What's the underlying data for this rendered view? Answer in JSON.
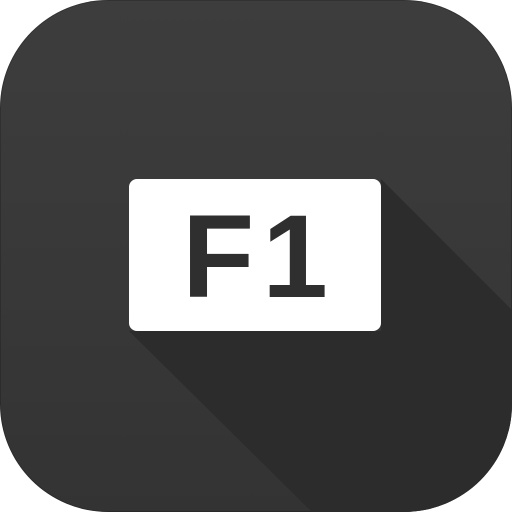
{
  "icon": {
    "semantic": "function-key-icon",
    "key_label": "F1",
    "colors": {
      "tile_background": "#3a3a3a",
      "long_shadow": "#2b2b2b",
      "key_cap": "#ffffff",
      "key_text": "#2f2f2f"
    }
  }
}
